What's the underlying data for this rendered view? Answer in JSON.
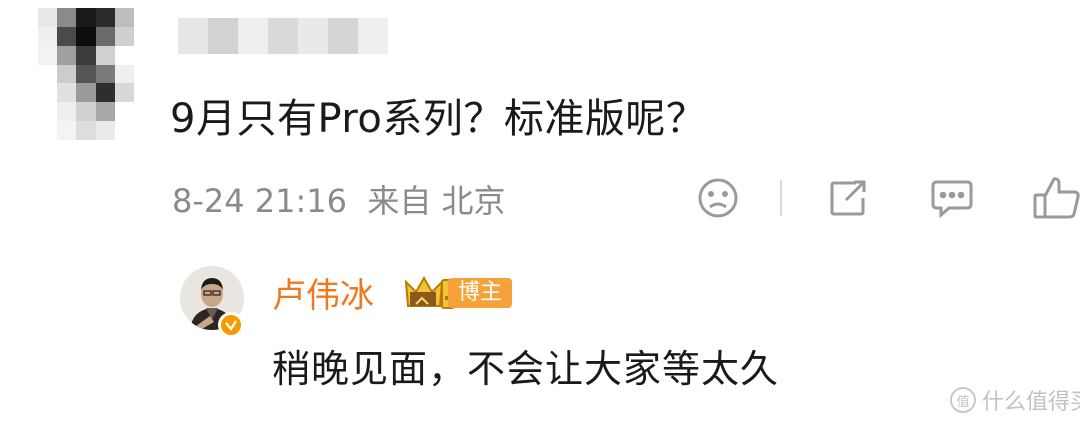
{
  "comment": {
    "text": "9月只有Pro系列？标准版呢？",
    "time": "8-24 21:16",
    "source": "来自 北京"
  },
  "actions": [
    {
      "icon": "sad-face-icon"
    },
    {
      "icon": "share-icon"
    },
    {
      "icon": "comment-icon"
    },
    {
      "icon": "like-icon"
    }
  ],
  "reply": {
    "author": "卢伟冰",
    "badge_label": "博主",
    "text": "稍晚见面，不会让大家等太久"
  },
  "watermark": {
    "text": "什么值得买"
  },
  "colors": {
    "author_name": "#f0781e",
    "badge_bg": "#f5a23a",
    "verify": "#f59a00",
    "meta": "#8a8a8a"
  }
}
